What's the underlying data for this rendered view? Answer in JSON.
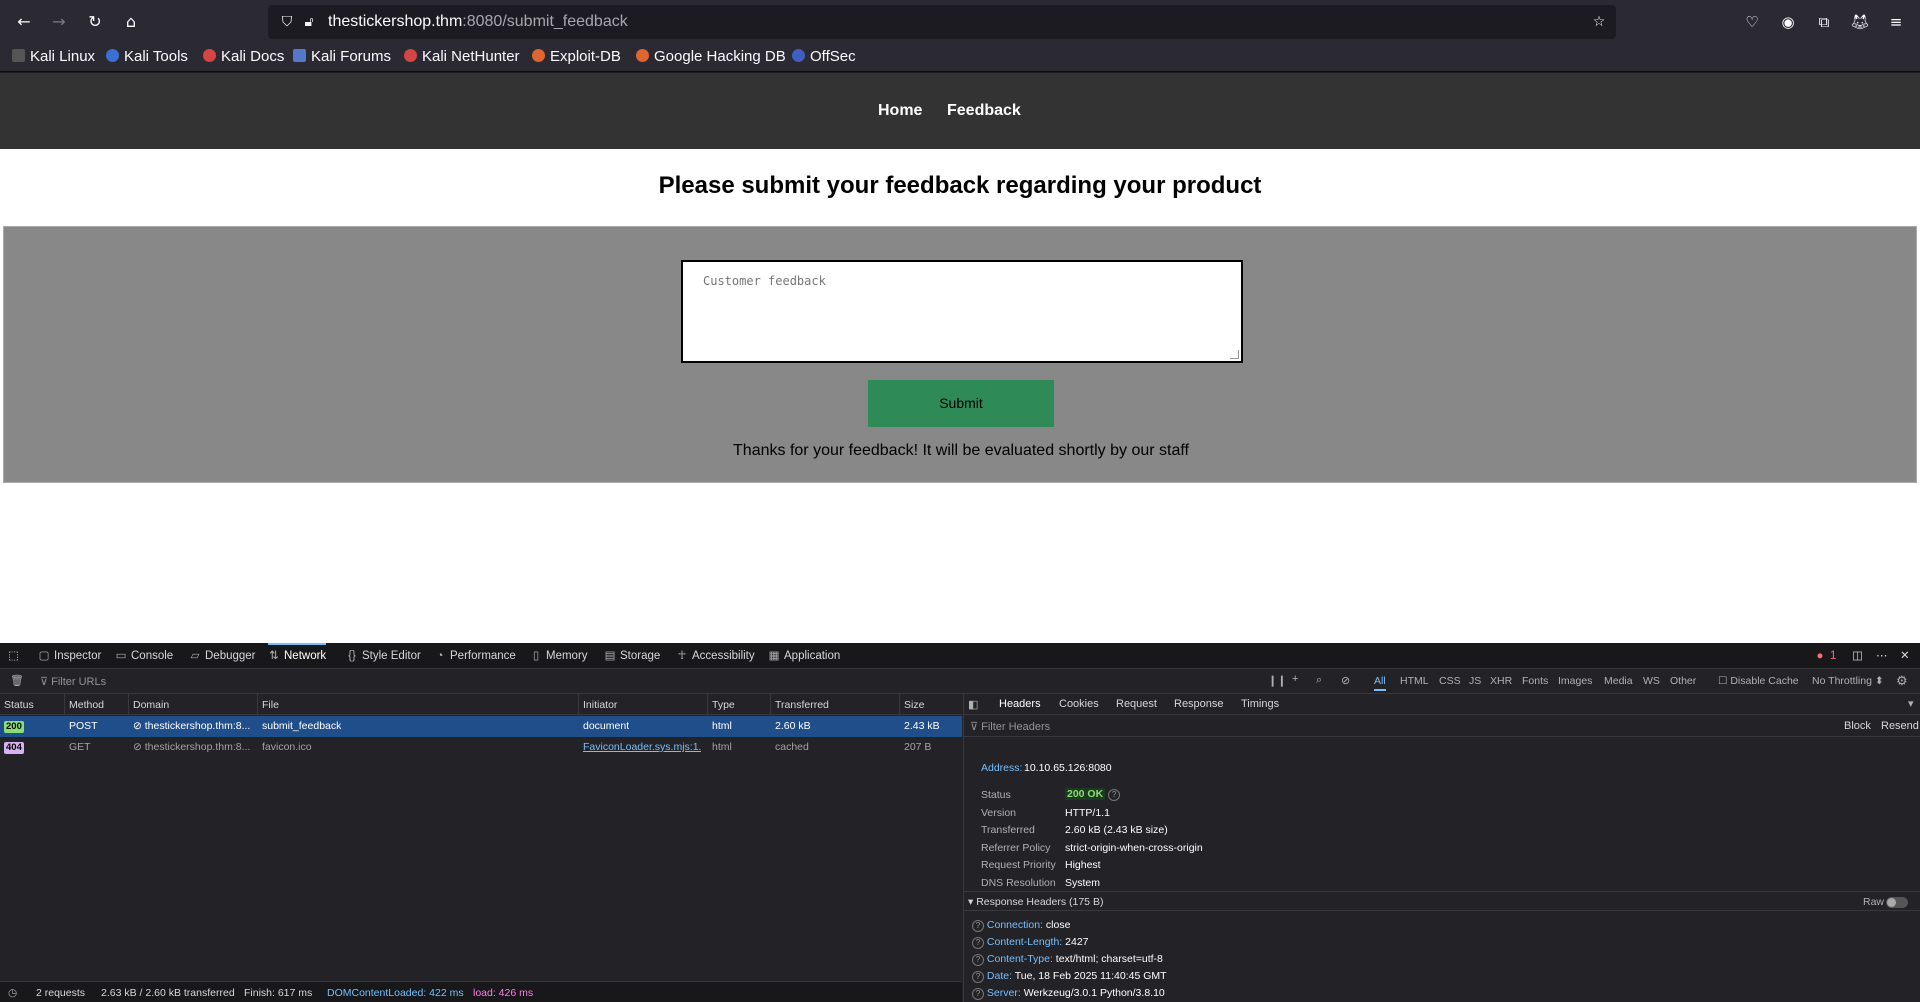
{
  "browser": {
    "url_host": "thestickershop.thm",
    "url_path": ":8080/submit_feedback",
    "bookmarks": [
      "Kali Linux",
      "Kali Tools",
      "Kali Docs",
      "Kali Forums",
      "Kali NetHunter",
      "Exploit-DB",
      "Google Hacking DB",
      "OffSec"
    ]
  },
  "site": {
    "nav": [
      "Home",
      "Feedback"
    ],
    "heading": "Please submit your feedback regarding your product",
    "feedback_placeholder": "Customer feedback",
    "submit_label": "Submit",
    "thanks": "Thanks for your feedback! It will be evaluated shortly by our staff"
  },
  "devtools": {
    "tabs": [
      "Inspector",
      "Console",
      "Debugger",
      "Network",
      "Style Editor",
      "Performance",
      "Memory",
      "Storage",
      "Accessibility",
      "Application"
    ],
    "active_tab": "Network",
    "error_count": "1",
    "filter_placeholder": "Filter URLs",
    "type_filters": [
      "All",
      "HTML",
      "CSS",
      "JS",
      "XHR",
      "Fonts",
      "Images",
      "Media",
      "WS",
      "Other"
    ],
    "disable_cache": "Disable Cache",
    "throttling": "No Throttling",
    "columns": [
      "Status",
      "Method",
      "Domain",
      "File",
      "Initiator",
      "Type",
      "Transferred",
      "Size"
    ],
    "requests": [
      {
        "status": "200",
        "method": "POST",
        "domain": "thestickershop.thm:8...",
        "file": "submit_feedback",
        "initiator": "document",
        "type": "html",
        "transferred": "2.60 kB",
        "size": "2.43 kB"
      },
      {
        "status": "404",
        "method": "GET",
        "domain": "thestickershop.thm:8...",
        "file": "favicon.ico",
        "initiator": "FaviconLoader.sys.mjs:1...",
        "type": "html",
        "transferred": "cached",
        "size": "207 B"
      }
    ],
    "summary": {
      "requests": "2 requests",
      "transferred": "2.63 kB / 2.60 kB transferred",
      "finish": "Finish: 617 ms",
      "dcl": "DOMContentLoaded: 422 ms",
      "load": "load: 426 ms"
    },
    "side_tabs": [
      "Headers",
      "Cookies",
      "Request",
      "Response",
      "Timings"
    ],
    "filter_headers": "Filter Headers",
    "block": "Block",
    "resend": "Resend",
    "address_label": "Address:",
    "address": "10.10.65.126:8080",
    "general": [
      {
        "k": "Status",
        "v": "200 OK"
      },
      {
        "k": "Version",
        "v": "HTTP/1.1"
      },
      {
        "k": "Transferred",
        "v": "2.60 kB (2.43 kB size)"
      },
      {
        "k": "Referrer Policy",
        "v": "strict-origin-when-cross-origin"
      },
      {
        "k": "Request Priority",
        "v": "Highest"
      },
      {
        "k": "DNS Resolution",
        "v": "System"
      }
    ],
    "response_headers_title": "Response Headers (175 B)",
    "raw": "Raw",
    "response_headers": [
      {
        "k": "Connection:",
        "v": "close"
      },
      {
        "k": "Content-Length:",
        "v": "2427"
      },
      {
        "k": "Content-Type:",
        "v": "text/html; charset=utf-8"
      },
      {
        "k": "Date:",
        "v": "Tue, 18 Feb 2025 11:40:45 GMT"
      },
      {
        "k": "Server:",
        "v": "Werkzeug/3.0.1 Python/3.8.10"
      }
    ]
  }
}
